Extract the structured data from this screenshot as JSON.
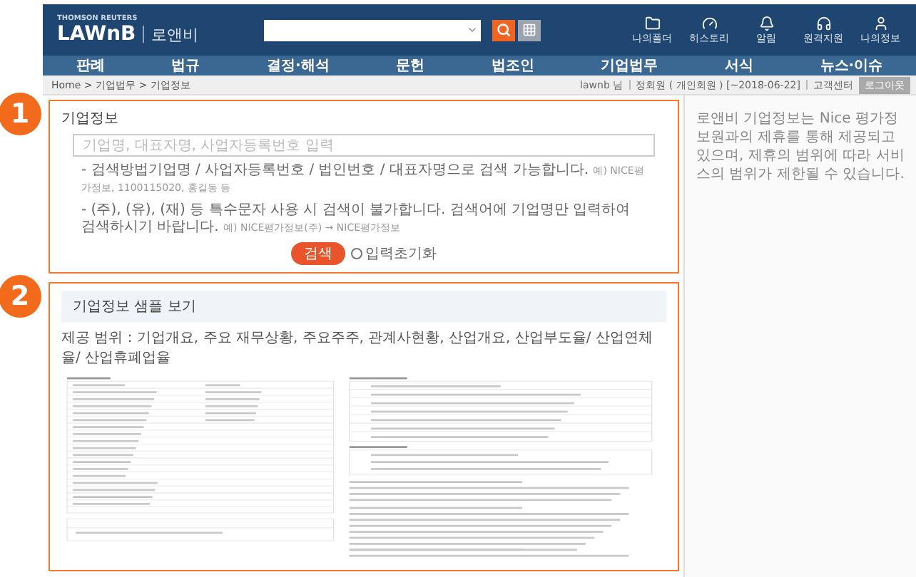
{
  "header": {
    "brand_small": "THOMSON REUTERS",
    "logo": "LAWnB",
    "logo_korean": "로앤비",
    "icons": [
      {
        "kind": "folder",
        "label": "나의폴더"
      },
      {
        "kind": "gauge",
        "label": "히스토리"
      },
      {
        "kind": "bell",
        "label": "알림"
      },
      {
        "kind": "headset",
        "label": "원격지원"
      },
      {
        "kind": "user",
        "label": "나의정보"
      }
    ]
  },
  "nav": [
    "판례",
    "법규",
    "결정·해석",
    "문헌",
    "법조인",
    "기업법무",
    "서식",
    "뉴스·이슈"
  ],
  "breadcrumb": "Home > 기업법무 > 기업정보",
  "account": {
    "items": [
      "lawnb 님",
      "정회원 ( 개인회원 ) [~2018-06-22]",
      "고객센터"
    ],
    "logout": "로그아웃"
  },
  "company_search": {
    "badge": "1",
    "title": "기업정보",
    "placeholder": "기업명, 대표자명, 사업자등록번호 입력",
    "hints": [
      {
        "text": "- 검색방법기업명 / 사업자등록번호 / 법인번호 / 대표자명으로 검색 가능합니다.",
        "example": "예) NICE평가정보, 1100115020, 홍길동 등"
      },
      {
        "text": "- (주), (유), (재) 등 특수문자 사용 시 검색이 불가합니다. 검색어에 기업명만 입력하여 검색하시기 바랍니다.",
        "example": "예) NICE평가정보(주) → NICE평가정보"
      }
    ],
    "search_button": "검색",
    "reset": {
      "label": "입력초기화",
      "checked": false
    }
  },
  "sample": {
    "badge": "2",
    "title": "기업정보 샘플 보기",
    "scope": "제공 범위 : 기업개요, 주요 재무상황, 주요주주, 관계사현황, 산업개요, 산업부도율/ 산업연체율/ 산업휴폐업율"
  },
  "notice": "로앤비 기업정보는 Nice 평가정보원과의 제휴를 통해 제공되고 있으며, 제휴의 범위에 따라 서비스의 범위가 제한될 수 있습니다."
}
